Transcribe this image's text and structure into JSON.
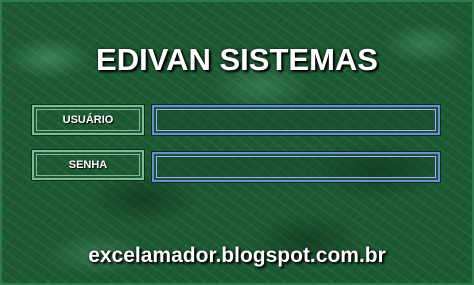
{
  "title": "EDIVAN SISTEMAS",
  "form": {
    "user_label": "USUÁRIO",
    "user_value": "",
    "password_label": "SENHA",
    "password_value": ""
  },
  "footer": "excelamador.blogspot.com.br",
  "colors": {
    "background": "#1c5a33",
    "text": "#ffffff",
    "input_border": "#6a8fd8"
  }
}
